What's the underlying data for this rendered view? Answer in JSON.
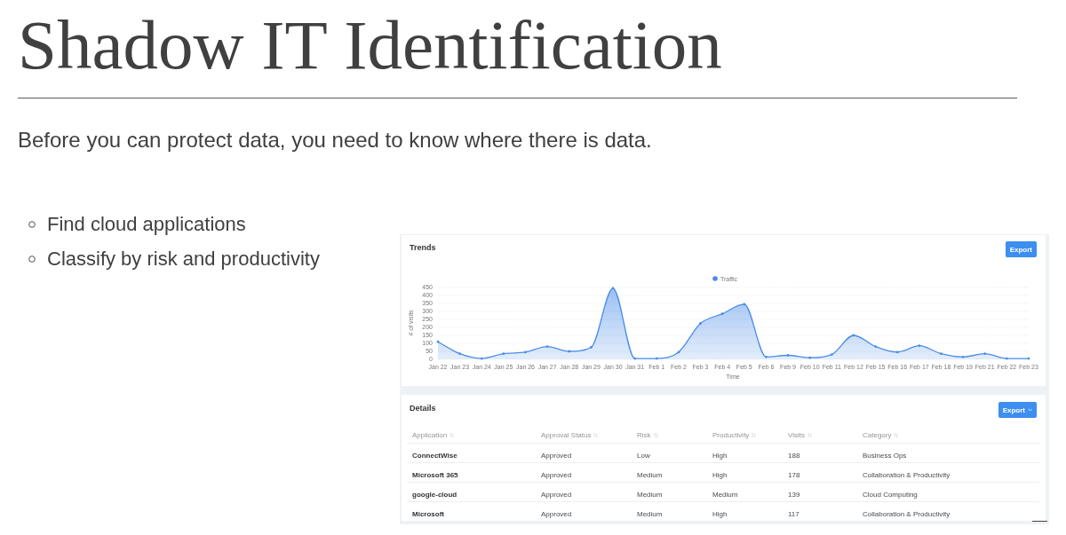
{
  "slide": {
    "title": "Shadow IT Identification",
    "subtitle": "Before you can protect data, you need to know where there is data.",
    "bullets": [
      "Find cloud applications",
      "Classify by risk and productivity"
    ]
  },
  "trends": {
    "title": "Trends",
    "export_button": {
      "label": "Export",
      "dropdown": false
    },
    "chart_data": {
      "type": "area",
      "xlabel": "Time",
      "ylabel": "# of visits",
      "grid": true,
      "categories": [
        "Jan 22",
        "Jan 23",
        "Jan 24",
        "Jan 25",
        "Jan 26",
        "Jan 27",
        "Jan 28",
        "Jan 29",
        "Jan 30",
        "Jan 31",
        "Feb 1",
        "Feb 2",
        "Feb 3",
        "Feb 4",
        "Feb 5",
        "Feb 6",
        "Feb 9",
        "Feb 10",
        "Feb 11",
        "Feb 12",
        "Feb 15",
        "Feb 16",
        "Feb 17",
        "Feb 18",
        "Feb 19",
        "Feb 21",
        "Feb 22",
        "Feb 23"
      ],
      "series": [
        {
          "name": "Traffic",
          "color": "#4a8de8",
          "values": [
            110,
            35,
            5,
            35,
            45,
            80,
            50,
            75,
            445,
            5,
            5,
            45,
            225,
            285,
            345,
            15,
            25,
            10,
            30,
            150,
            80,
            45,
            85,
            35,
            15,
            35,
            5,
            5
          ]
        }
      ],
      "ylim": [
        0,
        450
      ],
      "yticks": [
        0,
        50,
        100,
        150,
        200,
        250,
        300,
        350,
        400,
        450
      ]
    }
  },
  "details": {
    "title": "Details",
    "export_button": {
      "label": "Export",
      "dropdown": true
    },
    "columns": [
      "Application",
      "Approval Status",
      "Risk",
      "Productivity",
      "Visits",
      "Category"
    ],
    "rows": [
      [
        "ConnectWise",
        "Approved",
        "Low",
        "High",
        "188",
        "Business Ops"
      ],
      [
        "Microsoft 365",
        "Approved",
        "Medium",
        "High",
        "178",
        "Collaboration & Productivity"
      ],
      [
        "google-cloud",
        "Approved",
        "Medium",
        "Medium",
        "139",
        "Cloud Computing"
      ],
      [
        "Microsoft",
        "Approved",
        "Medium",
        "High",
        "117",
        "Collaboration & Productivity"
      ]
    ]
  }
}
